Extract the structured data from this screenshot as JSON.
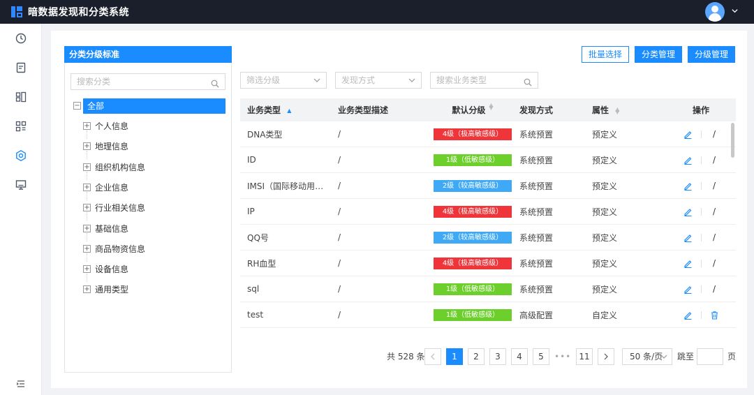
{
  "app": {
    "title": "暗数据发现和分类系统"
  },
  "left_panel": {
    "title": "分类分级标准",
    "search_placeholder": "搜索分类",
    "root": "全部",
    "nodes": [
      "个人信息",
      "地理信息",
      "组织机构信息",
      "企业信息",
      "行业相关信息",
      "基础信息",
      "商品物资信息",
      "设备信息",
      "通用类型"
    ]
  },
  "toolbar": {
    "batch_select": "批量选择",
    "category_manage": "分类管理",
    "level_manage": "分级管理"
  },
  "filters": {
    "level_placeholder": "筛选分级",
    "method_placeholder": "发现方式",
    "search_placeholder": "搜索业务类型"
  },
  "table": {
    "headers": [
      "业务类型",
      "业务类型描述",
      "默认分级",
      "发现方式",
      "属性",
      "操作"
    ],
    "rows": [
      {
        "name": "DNA类型",
        "desc": "/",
        "level": "4级（极高敏感级）",
        "method": "系统预置",
        "attr": "预定义",
        "op": "/"
      },
      {
        "name": "ID",
        "desc": "/",
        "level": "1级（低敏感级）",
        "method": "系统预置",
        "attr": "预定义",
        "op": "/"
      },
      {
        "name": "IMSI（国际移动用户...",
        "desc": "/",
        "level": "2级（较高敏感级）",
        "method": "系统预置",
        "attr": "预定义",
        "op": "/"
      },
      {
        "name": "IP",
        "desc": "/",
        "level": "4级（极高敏感级）",
        "method": "系统预置",
        "attr": "预定义",
        "op": "/"
      },
      {
        "name": "QQ号",
        "desc": "/",
        "level": "2级（较高敏感级）",
        "method": "系统预置",
        "attr": "预定义",
        "op": "/"
      },
      {
        "name": "RH血型",
        "desc": "/",
        "level": "4级（极高敏感级）",
        "method": "系统预置",
        "attr": "预定义",
        "op": "/"
      },
      {
        "name": "sql",
        "desc": "/",
        "level": "1级（低敏感级）",
        "method": "系统预置",
        "attr": "预定义",
        "op": "/"
      },
      {
        "name": "test",
        "desc": "/",
        "level": "1级（低敏感级）",
        "method": "高级配置",
        "attr": "自定义",
        "op": ""
      }
    ]
  },
  "level_colors": {
    "1": "#6dcf2c",
    "2": "#3fa9f5",
    "4": "#f0353a"
  },
  "icons": [
    "dashboard-icon",
    "document-icon",
    "scan-icon",
    "qrcode-icon",
    "settings-icon",
    "monitor-icon",
    "search-icon",
    "edit-icon",
    "delete-icon",
    "collapse-menu-icon"
  ],
  "pagination": {
    "total": "共 528 条",
    "pages": [
      "1",
      "2",
      "3",
      "4",
      "5"
    ],
    "dots": "•••",
    "last": "11",
    "current": "1",
    "page_size": "50 条/页",
    "jump_label": "跳至",
    "jump_unit": "页"
  }
}
